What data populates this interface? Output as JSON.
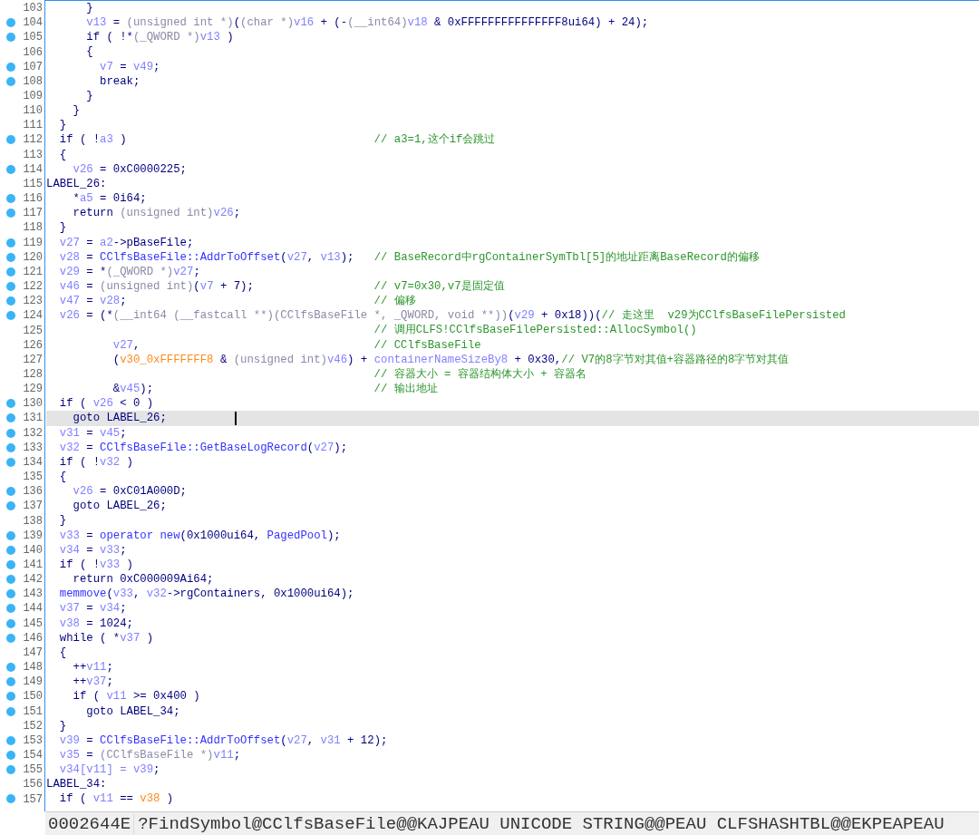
{
  "lines": [
    {
      "n": "103",
      "dot": false,
      "selected": false,
      "t": [
        {
          "kind": "plain",
          "text": "      }"
        }
      ]
    },
    {
      "n": "104",
      "dot": true,
      "selected": false,
      "t": [
        {
          "kind": "var",
          "text": "      v13"
        },
        {
          "kind": "plain",
          "text": " = "
        },
        {
          "kind": "type",
          "text": "(unsigned int *)"
        },
        {
          "kind": "plain",
          "text": "("
        },
        {
          "kind": "type",
          "text": "(char *)"
        },
        {
          "kind": "var",
          "text": "v16"
        },
        {
          "kind": "plain",
          "text": " + (-"
        },
        {
          "kind": "type",
          "text": "(__int64)"
        },
        {
          "kind": "var",
          "text": "v18"
        },
        {
          "kind": "plain",
          "text": " & 0xFFFFFFFFFFFFFFF8ui64) + 24);"
        }
      ]
    },
    {
      "n": "105",
      "dot": true,
      "selected": false,
      "t": [
        {
          "kind": "plain",
          "text": "      if ( !*"
        },
        {
          "kind": "type",
          "text": "(_QWORD *)"
        },
        {
          "kind": "var",
          "text": "v13"
        },
        {
          "kind": "plain",
          "text": " )"
        }
      ]
    },
    {
      "n": "106",
      "dot": false,
      "selected": false,
      "t": [
        {
          "kind": "plain",
          "text": "      {"
        }
      ]
    },
    {
      "n": "107",
      "dot": true,
      "selected": false,
      "t": [
        {
          "kind": "var",
          "text": "        v7"
        },
        {
          "kind": "plain",
          "text": " = "
        },
        {
          "kind": "var",
          "text": "v49"
        },
        {
          "kind": "plain",
          "text": ";"
        }
      ]
    },
    {
      "n": "108",
      "dot": true,
      "selected": false,
      "t": [
        {
          "kind": "plain",
          "text": "        break;"
        }
      ]
    },
    {
      "n": "109",
      "dot": false,
      "selected": false,
      "t": [
        {
          "kind": "plain",
          "text": "      }"
        }
      ]
    },
    {
      "n": "110",
      "dot": false,
      "selected": false,
      "t": [
        {
          "kind": "plain",
          "text": "    }"
        }
      ]
    },
    {
      "n": "111",
      "dot": false,
      "selected": false,
      "t": [
        {
          "kind": "plain",
          "text": "  }"
        }
      ]
    },
    {
      "n": "112",
      "dot": true,
      "selected": false,
      "t": [
        {
          "kind": "plain",
          "text": "  if ( !"
        },
        {
          "kind": "var",
          "text": "a3"
        },
        {
          "kind": "plain",
          "text": " )"
        },
        {
          "kind": "comment",
          "text": "                                     // a3=1,这个if会跳过"
        }
      ]
    },
    {
      "n": "113",
      "dot": false,
      "selected": false,
      "t": [
        {
          "kind": "plain",
          "text": "  {"
        }
      ]
    },
    {
      "n": "114",
      "dot": true,
      "selected": false,
      "t": [
        {
          "kind": "var",
          "text": "    v26"
        },
        {
          "kind": "plain",
          "text": " = 0xC0000225;"
        }
      ]
    },
    {
      "n": "115",
      "dot": false,
      "selected": false,
      "t": [
        {
          "kind": "plain",
          "text": "LABEL_26:"
        }
      ]
    },
    {
      "n": "116",
      "dot": true,
      "selected": false,
      "t": [
        {
          "kind": "plain",
          "text": "    *"
        },
        {
          "kind": "var",
          "text": "a5"
        },
        {
          "kind": "plain",
          "text": " = 0i64;"
        }
      ]
    },
    {
      "n": "117",
      "dot": true,
      "selected": false,
      "t": [
        {
          "kind": "plain",
          "text": "    return "
        },
        {
          "kind": "type",
          "text": "(unsigned int)"
        },
        {
          "kind": "var",
          "text": "v26"
        },
        {
          "kind": "plain",
          "text": ";"
        }
      ]
    },
    {
      "n": "118",
      "dot": false,
      "selected": false,
      "t": [
        {
          "kind": "plain",
          "text": "  }"
        }
      ]
    },
    {
      "n": "119",
      "dot": true,
      "selected": false,
      "t": [
        {
          "kind": "var",
          "text": "  v27"
        },
        {
          "kind": "plain",
          "text": " = "
        },
        {
          "kind": "var",
          "text": "a2"
        },
        {
          "kind": "plain",
          "text": "->pBaseFile;"
        }
      ]
    },
    {
      "n": "120",
      "dot": true,
      "selected": false,
      "t": [
        {
          "kind": "var",
          "text": "  v28"
        },
        {
          "kind": "plain",
          "text": " = "
        },
        {
          "kind": "func",
          "text": "CClfsBaseFile::AddrToOffset"
        },
        {
          "kind": "plain",
          "text": "("
        },
        {
          "kind": "var",
          "text": "v27"
        },
        {
          "kind": "plain",
          "text": ", "
        },
        {
          "kind": "var",
          "text": "v13"
        },
        {
          "kind": "plain",
          "text": ");"
        },
        {
          "kind": "comment",
          "text": "   // BaseRecord中rgContainerSymTbl[5]的地址距离BaseRecord的偏移"
        }
      ]
    },
    {
      "n": "121",
      "dot": true,
      "selected": false,
      "t": [
        {
          "kind": "var",
          "text": "  v29"
        },
        {
          "kind": "plain",
          "text": " = *"
        },
        {
          "kind": "type",
          "text": "(_QWORD *)"
        },
        {
          "kind": "var",
          "text": "v27"
        },
        {
          "kind": "plain",
          "text": ";"
        }
      ]
    },
    {
      "n": "122",
      "dot": true,
      "selected": false,
      "t": [
        {
          "kind": "var",
          "text": "  v46"
        },
        {
          "kind": "plain",
          "text": " = "
        },
        {
          "kind": "type",
          "text": "(unsigned int)"
        },
        {
          "kind": "plain",
          "text": "("
        },
        {
          "kind": "var",
          "text": "v7"
        },
        {
          "kind": "plain",
          "text": " + 7);"
        },
        {
          "kind": "comment",
          "text": "                  // v7=0x30,v7是固定值"
        }
      ]
    },
    {
      "n": "123",
      "dot": true,
      "selected": false,
      "t": [
        {
          "kind": "var",
          "text": "  v47"
        },
        {
          "kind": "plain",
          "text": " = "
        },
        {
          "kind": "var",
          "text": "v28"
        },
        {
          "kind": "plain",
          "text": ";"
        },
        {
          "kind": "comment",
          "text": "                                     // 偏移"
        }
      ]
    },
    {
      "n": "124",
      "dot": true,
      "selected": false,
      "t": [
        {
          "kind": "var",
          "text": "  v26"
        },
        {
          "kind": "plain",
          "text": " = (*"
        },
        {
          "kind": "type",
          "text": "(__int64 (__fastcall **)(CClfsBaseFile *, _QWORD, void **))"
        },
        {
          "kind": "plain",
          "text": "("
        },
        {
          "kind": "var",
          "text": "v29"
        },
        {
          "kind": "plain",
          "text": " + 0x18))("
        },
        {
          "kind": "comment",
          "text": "// 走这里  v29为CClfsBaseFilePersisted"
        }
      ]
    },
    {
      "n": "125",
      "dot": false,
      "selected": false,
      "t": [
        {
          "kind": "comment",
          "text": "                                                 // 调用CLFS!CClfsBaseFilePersisted::AllocSymbol()"
        }
      ]
    },
    {
      "n": "126",
      "dot": false,
      "selected": false,
      "t": [
        {
          "kind": "var",
          "text": "          v27"
        },
        {
          "kind": "plain",
          "text": ","
        },
        {
          "kind": "comment",
          "text": "                                   // CClfsBaseFile"
        }
      ]
    },
    {
      "n": "127",
      "dot": false,
      "selected": false,
      "t": [
        {
          "kind": "plain",
          "text": "          ("
        },
        {
          "kind": "hl",
          "text": "v30_0xFFFFFFF8"
        },
        {
          "kind": "plain",
          "text": " & "
        },
        {
          "kind": "type",
          "text": "(unsigned int)"
        },
        {
          "kind": "var",
          "text": "v46"
        },
        {
          "kind": "plain",
          "text": ") + "
        },
        {
          "kind": "var",
          "text": "containerNameSizeBy8"
        },
        {
          "kind": "plain",
          "text": " + 0x30,"
        },
        {
          "kind": "comment",
          "text": "// V7的8字节对其值+容器路径的8字节对其值"
        }
      ]
    },
    {
      "n": "128",
      "dot": false,
      "selected": false,
      "t": [
        {
          "kind": "comment",
          "text": "                                                 // 容器大小 = 容器结构体大小 + 容器名"
        }
      ]
    },
    {
      "n": "129",
      "dot": false,
      "selected": false,
      "t": [
        {
          "kind": "plain",
          "text": "          &"
        },
        {
          "kind": "var",
          "text": "v45"
        },
        {
          "kind": "plain",
          "text": ");"
        },
        {
          "kind": "comment",
          "text": "                                 // 输出地址"
        }
      ]
    },
    {
      "n": "130",
      "dot": true,
      "selected": false,
      "t": [
        {
          "kind": "plain",
          "text": "  if ( "
        },
        {
          "kind": "var",
          "text": "v26"
        },
        {
          "kind": "plain",
          "text": " < 0 )"
        }
      ]
    },
    {
      "n": "131",
      "dot": true,
      "selected": true,
      "t": [
        {
          "kind": "plain",
          "text": "    goto LABEL_26;"
        }
      ]
    },
    {
      "n": "132",
      "dot": true,
      "selected": false,
      "t": [
        {
          "kind": "var",
          "text": "  v31"
        },
        {
          "kind": "plain",
          "text": " = "
        },
        {
          "kind": "var",
          "text": "v45"
        },
        {
          "kind": "plain",
          "text": ";"
        }
      ]
    },
    {
      "n": "133",
      "dot": true,
      "selected": false,
      "t": [
        {
          "kind": "var",
          "text": "  v32"
        },
        {
          "kind": "plain",
          "text": " = "
        },
        {
          "kind": "func",
          "text": "CClfsBaseFile::GetBaseLogRecord"
        },
        {
          "kind": "plain",
          "text": "("
        },
        {
          "kind": "var",
          "text": "v27"
        },
        {
          "kind": "plain",
          "text": ");"
        }
      ]
    },
    {
      "n": "134",
      "dot": true,
      "selected": false,
      "t": [
        {
          "kind": "plain",
          "text": "  if ( !"
        },
        {
          "kind": "var",
          "text": "v32"
        },
        {
          "kind": "plain",
          "text": " )"
        }
      ]
    },
    {
      "n": "135",
      "dot": false,
      "selected": false,
      "t": [
        {
          "kind": "plain",
          "text": "  {"
        }
      ]
    },
    {
      "n": "136",
      "dot": true,
      "selected": false,
      "t": [
        {
          "kind": "var",
          "text": "    v26"
        },
        {
          "kind": "plain",
          "text": " = 0xC01A000D;"
        }
      ]
    },
    {
      "n": "137",
      "dot": true,
      "selected": false,
      "t": [
        {
          "kind": "plain",
          "text": "    goto LABEL_26;"
        }
      ]
    },
    {
      "n": "138",
      "dot": false,
      "selected": false,
      "t": [
        {
          "kind": "plain",
          "text": "  }"
        }
      ]
    },
    {
      "n": "139",
      "dot": true,
      "selected": false,
      "t": [
        {
          "kind": "var",
          "text": "  v33"
        },
        {
          "kind": "plain",
          "text": " = "
        },
        {
          "kind": "func",
          "text": "operator new"
        },
        {
          "kind": "plain",
          "text": "(0x1000ui64, "
        },
        {
          "kind": "func",
          "text": "PagedPool"
        },
        {
          "kind": "plain",
          "text": ");"
        }
      ]
    },
    {
      "n": "140",
      "dot": true,
      "selected": false,
      "t": [
        {
          "kind": "var",
          "text": "  v34"
        },
        {
          "kind": "plain",
          "text": " = "
        },
        {
          "kind": "var",
          "text": "v33"
        },
        {
          "kind": "plain",
          "text": ";"
        }
      ]
    },
    {
      "n": "141",
      "dot": true,
      "selected": false,
      "t": [
        {
          "kind": "plain",
          "text": "  if ( !"
        },
        {
          "kind": "var",
          "text": "v33"
        },
        {
          "kind": "plain",
          "text": " )"
        }
      ]
    },
    {
      "n": "142",
      "dot": true,
      "selected": false,
      "t": [
        {
          "kind": "plain",
          "text": "    return 0xC000009Ai64;"
        }
      ]
    },
    {
      "n": "143",
      "dot": true,
      "selected": false,
      "t": [
        {
          "kind": "func",
          "text": "  memmove"
        },
        {
          "kind": "plain",
          "text": "("
        },
        {
          "kind": "var",
          "text": "v33"
        },
        {
          "kind": "plain",
          "text": ", "
        },
        {
          "kind": "var",
          "text": "v32"
        },
        {
          "kind": "plain",
          "text": "->rgContainers, 0x1000ui64);"
        }
      ]
    },
    {
      "n": "144",
      "dot": true,
      "selected": false,
      "t": [
        {
          "kind": "var",
          "text": "  v37"
        },
        {
          "kind": "plain",
          "text": " = "
        },
        {
          "kind": "var",
          "text": "v34"
        },
        {
          "kind": "plain",
          "text": ";"
        }
      ]
    },
    {
      "n": "145",
      "dot": true,
      "selected": false,
      "t": [
        {
          "kind": "var",
          "text": "  v38"
        },
        {
          "kind": "plain",
          "text": " = 1024;"
        }
      ]
    },
    {
      "n": "146",
      "dot": true,
      "selected": false,
      "t": [
        {
          "kind": "plain",
          "text": "  while ( *"
        },
        {
          "kind": "var",
          "text": "v37"
        },
        {
          "kind": "plain",
          "text": " )"
        }
      ]
    },
    {
      "n": "147",
      "dot": false,
      "selected": false,
      "t": [
        {
          "kind": "plain",
          "text": "  {"
        }
      ]
    },
    {
      "n": "148",
      "dot": true,
      "selected": false,
      "t": [
        {
          "kind": "plain",
          "text": "    ++"
        },
        {
          "kind": "var",
          "text": "v11"
        },
        {
          "kind": "plain",
          "text": ";"
        }
      ]
    },
    {
      "n": "149",
      "dot": true,
      "selected": false,
      "t": [
        {
          "kind": "plain",
          "text": "    ++"
        },
        {
          "kind": "var",
          "text": "v37"
        },
        {
          "kind": "plain",
          "text": ";"
        }
      ]
    },
    {
      "n": "150",
      "dot": true,
      "selected": false,
      "t": [
        {
          "kind": "plain",
          "text": "    if ( "
        },
        {
          "kind": "var",
          "text": "v11"
        },
        {
          "kind": "plain",
          "text": " >= 0x400 )"
        }
      ]
    },
    {
      "n": "151",
      "dot": true,
      "selected": false,
      "t": [
        {
          "kind": "plain",
          "text": "      goto LABEL_34;"
        }
      ]
    },
    {
      "n": "152",
      "dot": false,
      "selected": false,
      "t": [
        {
          "kind": "plain",
          "text": "  }"
        }
      ]
    },
    {
      "n": "153",
      "dot": true,
      "selected": false,
      "t": [
        {
          "kind": "var",
          "text": "  v39"
        },
        {
          "kind": "plain",
          "text": " = "
        },
        {
          "kind": "func",
          "text": "CClfsBaseFile::AddrToOffset"
        },
        {
          "kind": "plain",
          "text": "("
        },
        {
          "kind": "var",
          "text": "v27"
        },
        {
          "kind": "plain",
          "text": ", "
        },
        {
          "kind": "var",
          "text": "v31"
        },
        {
          "kind": "plain",
          "text": " + 12);"
        }
      ]
    },
    {
      "n": "154",
      "dot": true,
      "selected": false,
      "t": [
        {
          "kind": "var",
          "text": "  v35"
        },
        {
          "kind": "plain",
          "text": " = "
        },
        {
          "kind": "type",
          "text": "(CClfsBaseFile *)"
        },
        {
          "kind": "var",
          "text": "v11"
        },
        {
          "kind": "plain",
          "text": ";"
        }
      ]
    },
    {
      "n": "155",
      "dot": true,
      "selected": false,
      "t": [
        {
          "kind": "var",
          "text": "  v34[v11] = v39"
        },
        {
          "kind": "plain",
          "text": ";"
        }
      ]
    },
    {
      "n": "156",
      "dot": false,
      "selected": false,
      "t": [
        {
          "kind": "plain",
          "text": "LABEL_34:"
        }
      ]
    },
    {
      "n": "157",
      "dot": true,
      "selected": false,
      "t": [
        {
          "kind": "plain",
          "text": "  if ( "
        },
        {
          "kind": "var",
          "text": "v11"
        },
        {
          "kind": "plain",
          "text": " == "
        },
        {
          "kind": "hl",
          "text": "v38"
        },
        {
          "kind": "plain",
          "text": " )"
        }
      ]
    }
  ],
  "status_bar": {
    "address": "0002644E",
    "symbol": "?FindSymbol@CClfsBaseFile@@KAJPEAU UNICODE STRING@@PEAU CLFSHASHTBL@@EKPEAPEAU"
  }
}
